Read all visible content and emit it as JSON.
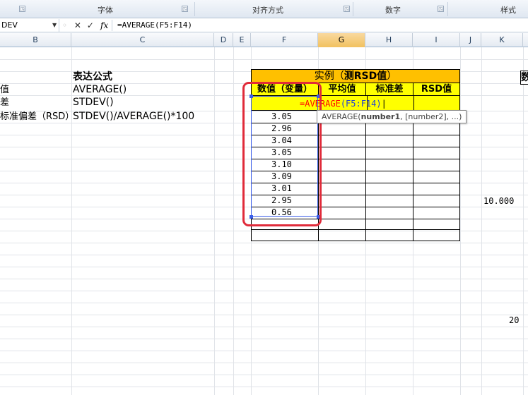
{
  "ribbon": {
    "groups": [
      {
        "label": "字体"
      },
      {
        "label": "对齐方式"
      },
      {
        "label": "数字"
      },
      {
        "label": "样式"
      }
    ]
  },
  "formula_bar": {
    "name_box": "DEV",
    "icons": [
      "cancel-icon",
      "enter-icon"
    ],
    "fx_label": "fx",
    "formula": "=AVERAGE(F5:F14)"
  },
  "columns": [
    "B",
    "C",
    "D",
    "E",
    "F",
    "G",
    "H",
    "I",
    "J",
    "K"
  ],
  "selected_column": "G",
  "left_section": {
    "heading_b": "",
    "heading_c": "表达公式",
    "rows": [
      {
        "b": "值",
        "c": "AVERAGE()"
      },
      {
        "b": "差",
        "c": "STDEV()"
      },
      {
        "b": "标准偏差（RSD）",
        "c": "STDEV()/AVERAGE()*100"
      }
    ]
  },
  "example_table": {
    "title_prefix": "实例（",
    "title_bold": "测RSD值",
    "title_suffix": "）",
    "headers": [
      "数值（变量）",
      "平均值",
      "标准差",
      "RSD值"
    ],
    "formula_prefix": "=",
    "formula_func": "AVERAGE",
    "formula_range": "(F5:F14)",
    "values": [
      "3.05",
      "2.96",
      "3.04",
      "3.05",
      "3.10",
      "3.09",
      "3.01",
      "2.95",
      "0.56"
    ]
  },
  "tooltip": {
    "func": "AVERAGE(",
    "arg1": "number1",
    "rest": ", [number2], ...)"
  },
  "right_side": {
    "k_value": "10.000",
    "k_value2": "20",
    "edge_char": "数"
  },
  "colors": {
    "table_title_bg": "#ffc000",
    "table_header_bg": "#ffff00",
    "selection_ring": "#e02b3a",
    "range_border": "#3b5ee8",
    "formula_red": "#ff0000",
    "formula_blue": "#1f3fd6"
  }
}
